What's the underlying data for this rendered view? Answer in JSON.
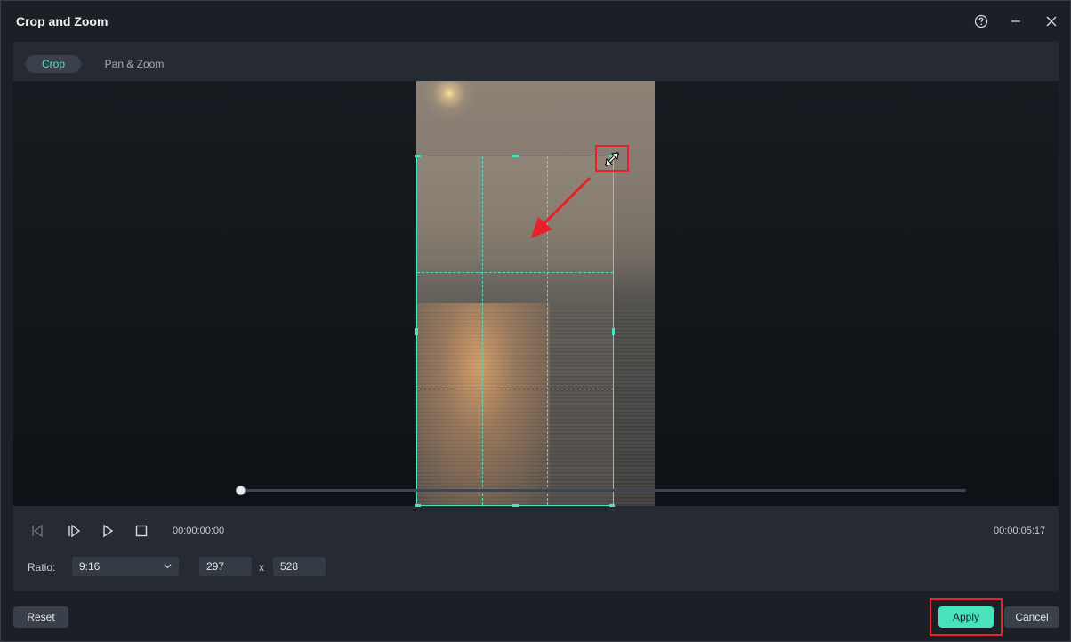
{
  "window": {
    "title": "Crop and Zoom"
  },
  "tabs": [
    {
      "label": "Crop",
      "active": true
    },
    {
      "label": "Pan & Zoom",
      "active": false
    }
  ],
  "playback": {
    "current_time": "00:00:00:00",
    "total_time": "00:00:05:17",
    "progress": 0
  },
  "settings": {
    "ratio_label": "Ratio:",
    "ratio_value": "9:16",
    "width": "297",
    "separator": "x",
    "height": "528"
  },
  "buttons": {
    "reset": "Reset",
    "apply": "Apply",
    "cancel": "Cancel"
  },
  "icons": {
    "help": "help-circle-icon",
    "minimize": "minimize-icon",
    "close": "close-icon",
    "prev_frame": "previous-frame-icon",
    "next_frame": "next-frame-icon",
    "play": "play-icon",
    "stop": "stop-icon",
    "dropdown": "chevron-down-icon",
    "resize": "diagonal-resize-icon"
  },
  "colors": {
    "accent": "#4fe0c0",
    "apply_button": "#48e3bd",
    "annotation": "#e8202a"
  }
}
